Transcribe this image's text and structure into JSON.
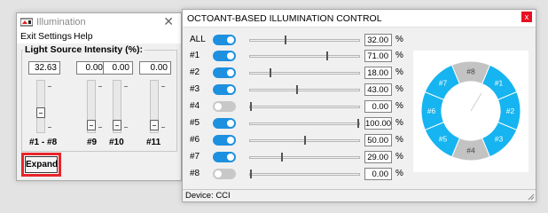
{
  "small_window": {
    "title": "Illumination",
    "close": "✕",
    "menu": [
      "Exit",
      "Settings",
      "Help"
    ],
    "group_label": "Light Source Intensity (%):",
    "channels": [
      {
        "value": "32.63",
        "label": "#1 - #8",
        "level": 0.3263
      },
      {
        "value": "0.00",
        "label": "#9",
        "level": 0
      },
      {
        "value": "0.00",
        "label": "#10",
        "level": 0
      },
      {
        "value": "0.00",
        "label": "#11",
        "level": 0
      }
    ],
    "expand_label": "Expand"
  },
  "big_window": {
    "title": "OCTOANT-BASED ILLUMINATION CONTROL",
    "close": "x",
    "rows": [
      {
        "label": "ALL",
        "on": true,
        "value": "32.00",
        "level": 0.32
      },
      {
        "label": "#1",
        "on": true,
        "value": "71.00",
        "level": 0.71
      },
      {
        "label": "#2",
        "on": true,
        "value": "18.00",
        "level": 0.18
      },
      {
        "label": "#3",
        "on": true,
        "value": "43.00",
        "level": 0.43
      },
      {
        "label": "#4",
        "on": false,
        "value": "0.00",
        "level": 0
      },
      {
        "label": "#5",
        "on": true,
        "value": "100.00",
        "level": 1.0
      },
      {
        "label": "#6",
        "on": true,
        "value": "50.00",
        "level": 0.5
      },
      {
        "label": "#7",
        "on": true,
        "value": "29.00",
        "level": 0.29
      },
      {
        "label": "#8",
        "on": false,
        "value": "0.00",
        "level": 0
      }
    ],
    "percent_sign": "%",
    "ring_segments": [
      {
        "label": "#1",
        "on": true
      },
      {
        "label": "#2",
        "on": true
      },
      {
        "label": "#3",
        "on": true
      },
      {
        "label": "#4",
        "on": false
      },
      {
        "label": "#5",
        "on": true
      },
      {
        "label": "#6",
        "on": true
      },
      {
        "label": "#7",
        "on": true
      },
      {
        "label": "#8",
        "on": false
      }
    ],
    "status": "Device: CCI"
  },
  "colors": {
    "toggle_on": "#1e90e0",
    "toggle_off": "#c8c8c8",
    "segment_on": "#16b4f0",
    "segment_off": "#c3c3c3",
    "highlight": "#e8252b"
  }
}
